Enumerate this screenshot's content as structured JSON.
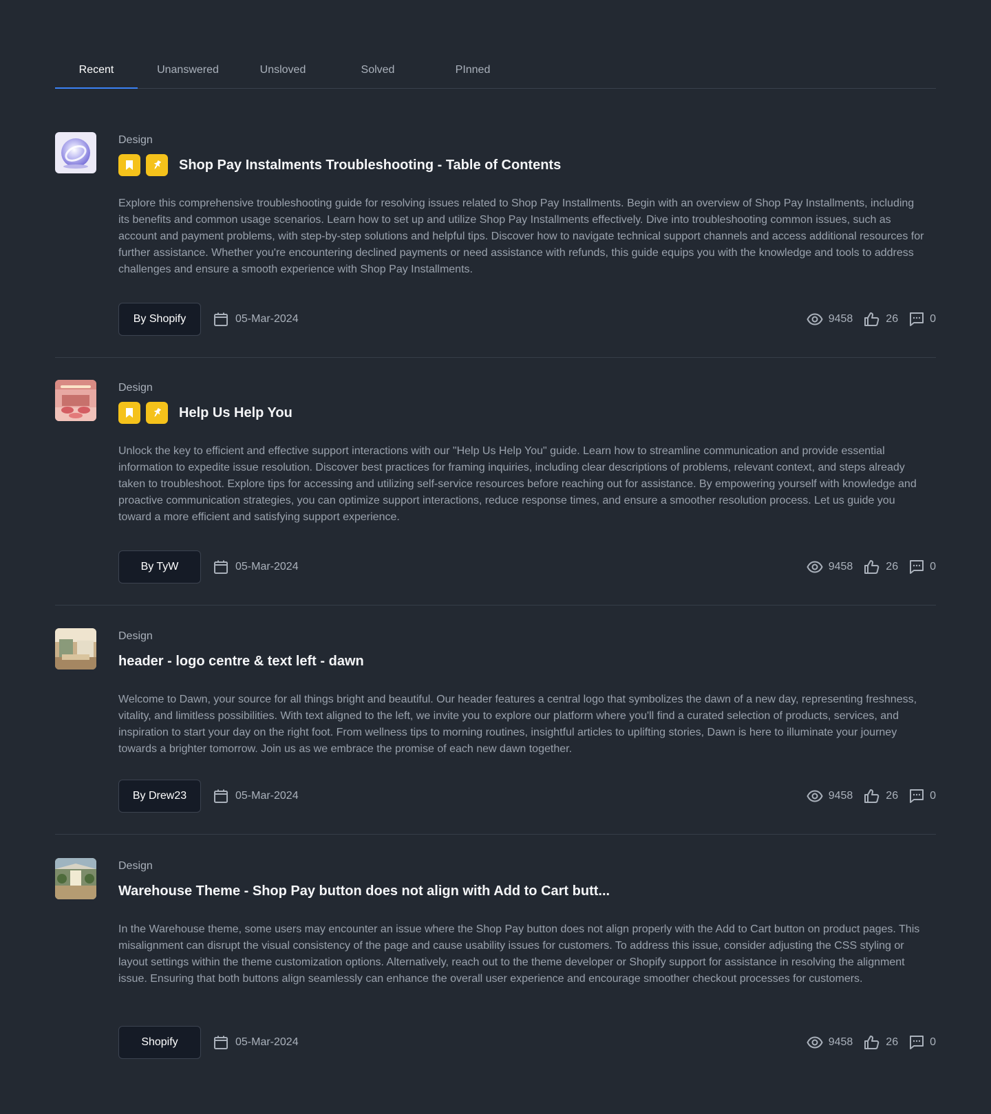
{
  "tabs": [
    {
      "label": "Recent",
      "active": true
    },
    {
      "label": "Unanswered",
      "active": false
    },
    {
      "label": "Unsloved",
      "active": false
    },
    {
      "label": "Solved",
      "active": false
    },
    {
      "label": "PInned",
      "active": false
    }
  ],
  "colors": {
    "background": "#232932",
    "badge": "#f5c21b",
    "tab_indicator": "#3b82f6"
  },
  "posts": [
    {
      "category": "Design",
      "title": "Shop Pay Instalments Troubleshooting - Table of Contents",
      "bookmarked": true,
      "pinned": true,
      "thumbnail": "glass-sphere-image",
      "description": "Explore this comprehensive troubleshooting guide for resolving issues related to Shop Pay Installments. Begin with an overview of Shop Pay Installments, including its benefits and common usage scenarios. Learn how to set up and utilize Shop Pay Installments effectively. Dive into troubleshooting common issues, such as account and payment problems, with step-by-step solutions and helpful tips. Discover how to navigate technical support channels and access additional resources for further assistance. Whether you're encountering declined payments or need assistance with refunds, this guide equips you with the knowledge and tools to address challenges and ensure a smooth experience with Shop Pay Installments.",
      "author": "By Shopify",
      "date": "05-Mar-2024",
      "views": "9458",
      "likes": "26",
      "comments": "0"
    },
    {
      "category": "Design",
      "title": "Help Us Help You",
      "bookmarked": true,
      "pinned": true,
      "thumbnail": "pink-interior-image",
      "description": "Unlock the key to efficient and effective support interactions with our \"Help Us Help You\" guide. Learn how to streamline communication and provide essential information to expedite issue resolution. Discover best practices for framing inquiries, including clear descriptions of problems, relevant context, and steps already taken to troubleshoot. Explore tips for accessing and utilizing self-service resources before reaching out for assistance. By empowering yourself with knowledge and proactive communication strategies, you can optimize support interactions, reduce response times, and ensure a smoother resolution process. Let us guide you toward a more efficient and satisfying support experience.",
      "author": "By TyW",
      "date": "05-Mar-2024",
      "views": "9458",
      "likes": "26",
      "comments": "0"
    },
    {
      "category": "Design",
      "title": "header - logo centre & text left  - dawn",
      "bookmarked": false,
      "pinned": false,
      "thumbnail": "store-interior-image",
      "description": "Welcome to Dawn, your source for all things bright and beautiful. Our header features a central logo that symbolizes the dawn of a new day, representing freshness, vitality, and limitless possibilities. With text aligned to the left, we invite you to explore our platform where you'll find a curated selection of products, services, and inspiration to start your day on the right foot. From wellness tips to morning routines, insightful articles to uplifting stories, Dawn is here to illuminate your journey towards a brighter tomorrow. Join us as we embrace the promise of each new dawn together.",
      "author": "By Drew23",
      "date": "05-Mar-2024",
      "views": "9458",
      "likes": "26",
      "comments": "0"
    },
    {
      "category": "Design",
      "title": "Warehouse Theme - Shop Pay button does not align with Add to Cart butt...",
      "bookmarked": false,
      "pinned": false,
      "thumbnail": "greenhouse-interior-image",
      "description": "In the Warehouse theme, some users may encounter an issue where the Shop Pay button does not align properly with the Add to Cart button on product pages. This misalignment can disrupt the visual consistency of the page and cause usability issues for customers. To address this issue, consider adjusting the CSS styling or layout settings within the theme customization options. Alternatively, reach out to the theme developer or Shopify support for assistance in resolving the alignment issue. Ensuring that both buttons align seamlessly can enhance the overall user experience and encourage smoother checkout processes for customers.",
      "author": "Shopify",
      "date": "05-Mar-2024",
      "views": "9458",
      "likes": "26",
      "comments": "0"
    }
  ]
}
